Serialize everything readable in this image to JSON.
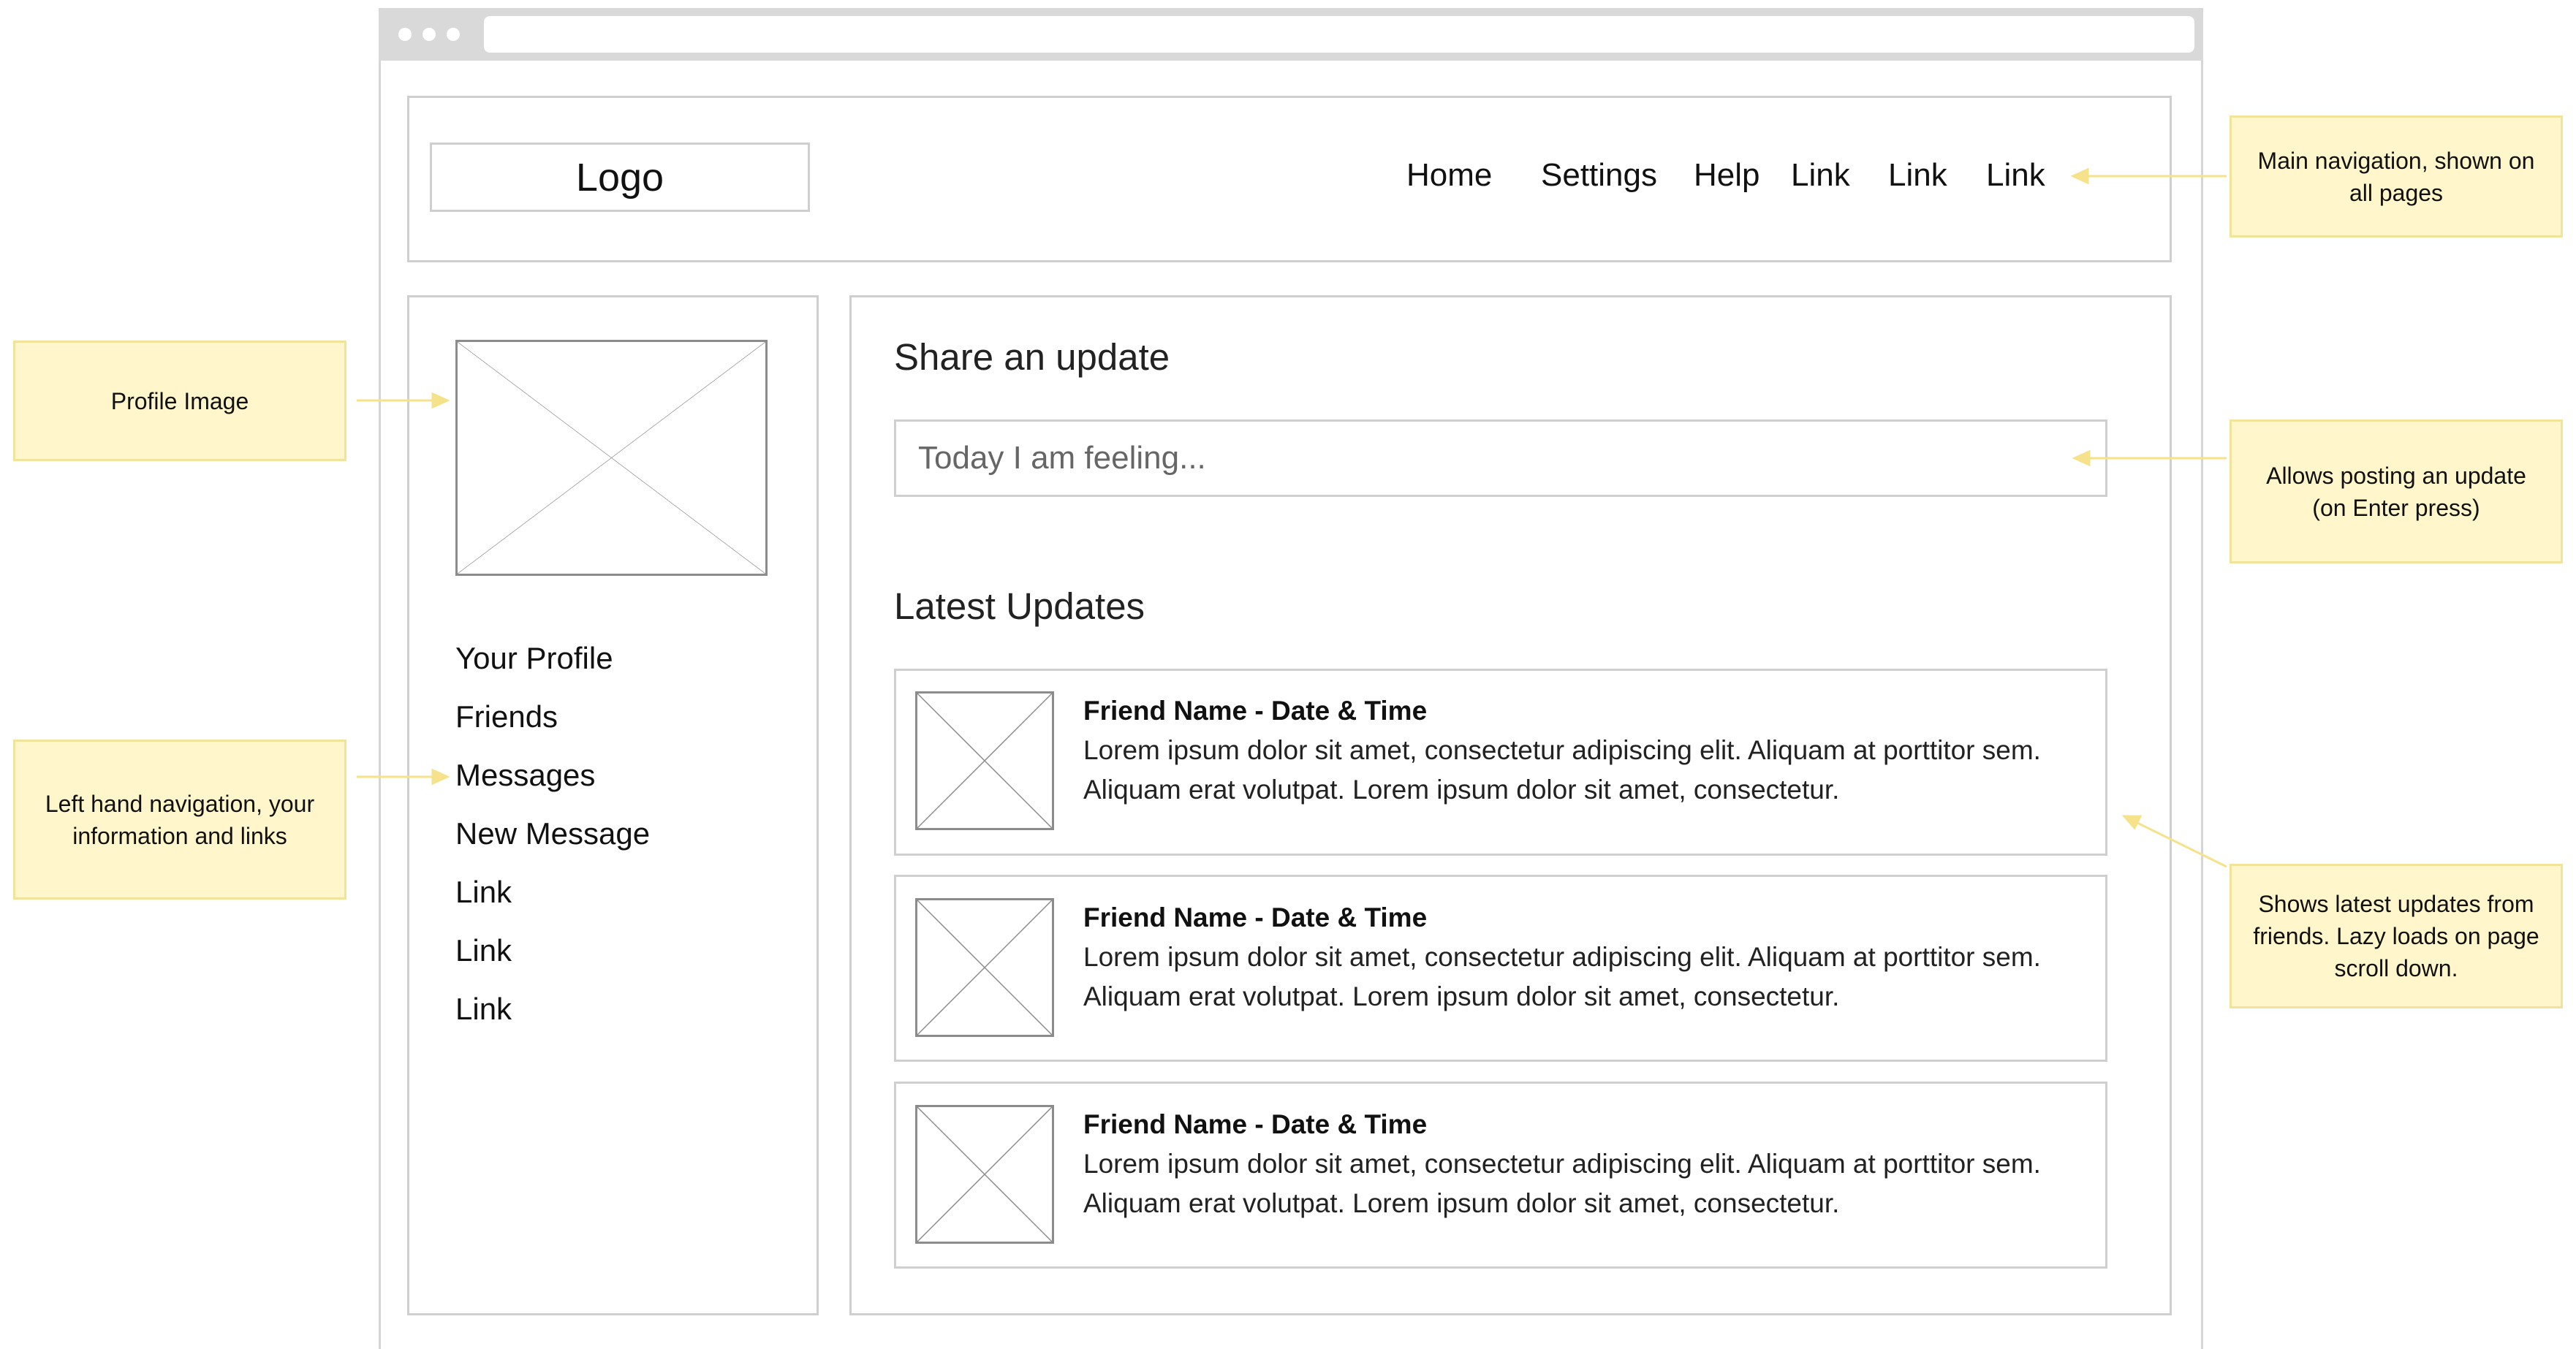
{
  "header": {
    "logo": "Logo",
    "nav": [
      "Home",
      "Settings",
      "Help",
      "Link",
      "Link",
      "Link"
    ]
  },
  "sidebar": {
    "links": [
      "Your Profile",
      "Friends",
      "Messages",
      "New Message",
      "Link",
      "Link",
      "Link"
    ]
  },
  "share": {
    "heading": "Share an update",
    "placeholder": "Today I am feeling..."
  },
  "updates": {
    "heading": "Latest Updates",
    "items": [
      {
        "title": "Friend Name - Date & Time",
        "body": "Lorem ipsum dolor sit amet, consectetur adipiscing elit. Aliquam at porttitor sem. Aliquam erat volutpat. Lorem ipsum dolor sit amet, consectetur."
      },
      {
        "title": "Friend Name - Date & Time",
        "body": "Lorem ipsum dolor sit amet, consectetur adipiscing elit. Aliquam at porttitor sem. Aliquam erat volutpat. Lorem ipsum dolor sit amet, consectetur."
      },
      {
        "title": "Friend Name - Date & Time",
        "body": "Lorem ipsum dolor sit amet, consectetur adipiscing elit. Aliquam at porttitor sem. Aliquam erat volutpat. Lorem ipsum dolor sit amet, consectetur."
      }
    ]
  },
  "annotations": {
    "main_nav": "Main navigation, shown on all pages",
    "profile_image": "Profile Image",
    "posting": "Allows posting an update (on Enter press)",
    "left_nav": "Left hand navigation, your information and links",
    "latest": "Shows latest updates from friends. Lazy loads on page scroll down."
  },
  "colors": {
    "note_fill": "#fff6cc",
    "note_border": "#f2e39a",
    "arrow": "#f5e28a",
    "frame": "#cfcfcf"
  }
}
